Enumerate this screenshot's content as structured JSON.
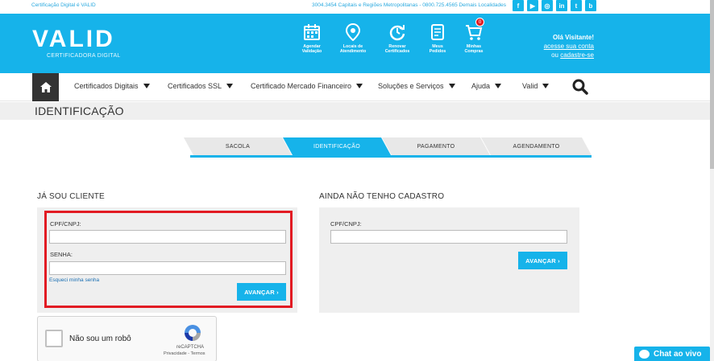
{
  "topbar": {
    "left_text": "Certificação Digital é VALID",
    "phones": "3004.3454 Capitais e Regiões Metropolitanas - 0800.725.4565 Demais Localidades",
    "social": [
      {
        "icon": "facebook-icon",
        "glyph": "f"
      },
      {
        "icon": "youtube-icon",
        "glyph": "▶"
      },
      {
        "icon": "instagram-icon",
        "glyph": "◎"
      },
      {
        "icon": "linkedin-icon",
        "glyph": "in"
      },
      {
        "icon": "twitter-icon",
        "glyph": "t"
      },
      {
        "icon": "blog-icon",
        "glyph": "b"
      }
    ]
  },
  "header": {
    "logo": "VALID",
    "logo_sub": "CERTIFICADORA DIGITAL",
    "icons": [
      {
        "name": "calendar-icon",
        "label1": "Agendar",
        "label2": "Validação"
      },
      {
        "name": "map-pin-icon",
        "label1": "Locais de",
        "label2": "Atendimento"
      },
      {
        "name": "renew-icon",
        "label1": "Renovar",
        "label2": "Certificados"
      },
      {
        "name": "orders-icon",
        "label1": "Meus",
        "label2": "Pedidos"
      },
      {
        "name": "cart-icon",
        "label1": "Minhas",
        "label2": "Compras"
      }
    ],
    "cart_count": "0",
    "greeting": "Olá Visitante!",
    "login_link": "acesse sua conta",
    "or_text": "ou",
    "signup_link": "cadastre-se"
  },
  "nav": {
    "items": [
      "Certificados Digitais",
      "Certificados SSL",
      "Certificado Mercado Financeiro",
      "Soluções e Serviços",
      "Ajuda",
      "Valid"
    ]
  },
  "page": {
    "title": "IDENTIFICAÇÃO"
  },
  "steps": [
    "SACOLA",
    "IDENTIFICAÇÃO",
    "PAGAMENTO",
    "AGENDAMENTO"
  ],
  "login": {
    "title": "JÁ SOU CLIENTE",
    "cpf_label": "CPF/CNPJ:",
    "password_label": "SENHA:",
    "forgot": "Esqueci minha senha",
    "submit": "AVANÇAR ›"
  },
  "register": {
    "title": "AINDA NÃO TENHO CADASTRO",
    "cpf_label": "CPF/CNPJ:",
    "submit": "AVANÇAR ›"
  },
  "captcha": {
    "label": "Não sou um robô",
    "brand": "reCAPTCHA",
    "terms": "Privacidade - Termos"
  },
  "chat": {
    "label": "Chat ao vivo"
  },
  "colors": {
    "brand_blue": "#16b3ea",
    "highlight_red": "#e21b23"
  }
}
